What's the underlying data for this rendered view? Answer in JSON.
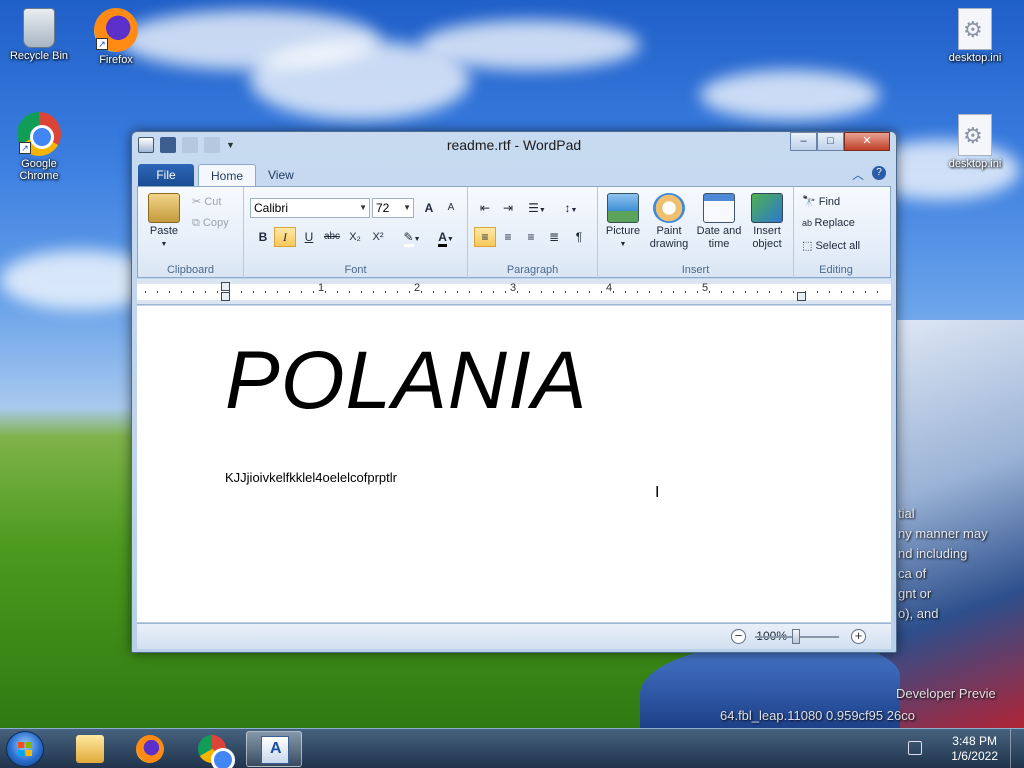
{
  "desktop": {
    "icons": [
      {
        "label": "Recycle Bin"
      },
      {
        "label": "Firefox"
      },
      {
        "label": "Google Chrome"
      },
      {
        "label": "desktop.ini"
      },
      {
        "label": "desktop.ini"
      }
    ],
    "watermark_lines": [
      "tial",
      "ny manner may",
      "nd including",
      "ca  of",
      "gnt  or",
      "o), and"
    ],
    "build_lines": [
      "Developer Previe",
      "64.fbl_leap.11080   0.959cf95   26co"
    ]
  },
  "window": {
    "title": "readme.rtf - WordPad",
    "controls": {
      "minimize": "–",
      "maximize": "□",
      "close": "✕"
    },
    "tabs": {
      "file": "File",
      "home": "Home",
      "view": "View"
    },
    "ribbon": {
      "clipboard": {
        "paste": "Paste",
        "cut": "Cut",
        "copy": "Copy",
        "label": "Clipboard"
      },
      "font": {
        "family": "Calibri",
        "size": "72",
        "label": "Font",
        "bold": "B",
        "italic": "I",
        "underline": "U",
        "strike": "abc",
        "subscript": "X₂",
        "superscript": "X²",
        "grow": "A",
        "shrink": "A"
      },
      "paragraph": {
        "label": "Paragraph"
      },
      "insert": {
        "picture": "Picture",
        "paint": "Paint drawing",
        "datetime": "Date and time",
        "object": "Insert object",
        "label": "Insert"
      },
      "editing": {
        "find": "Find",
        "replace": "Replace",
        "select_all": "Select all",
        "label": "Editing"
      }
    },
    "ruler": {
      "numbers": [
        "1",
        "2",
        "3",
        "4",
        "5"
      ]
    },
    "document": {
      "heading": "POLANIA",
      "body": "KJJjioivkelfkklel4oelelcofprptlr"
    },
    "status": {
      "zoom": "100%"
    }
  },
  "taskbar": {
    "time": "3:48 PM",
    "date": "1/6/2022"
  }
}
